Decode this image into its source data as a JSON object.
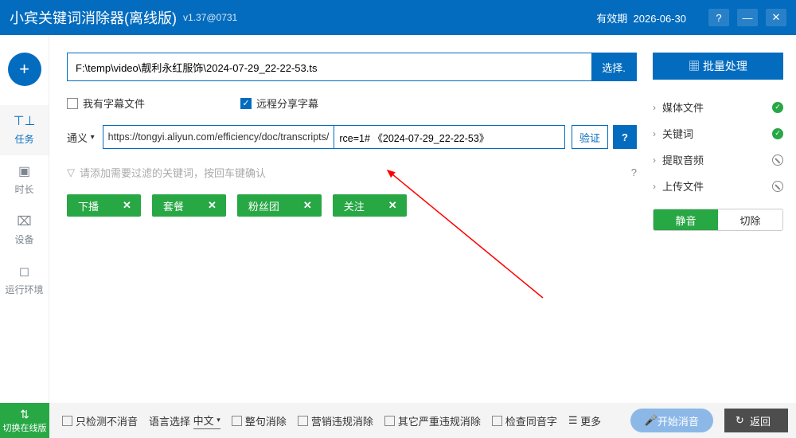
{
  "titlebar": {
    "title": "小宾关键词消除器(离线版)",
    "version": "v1.37@0731",
    "valid_label": "有效期",
    "valid_date": "2026-06-30"
  },
  "sidebar": {
    "items": [
      {
        "icon": "⊥",
        "label": "任务"
      },
      {
        "icon": "▣",
        "label": "时长"
      },
      {
        "icon": "⌧",
        "label": "设备"
      },
      {
        "icon": "◻",
        "label": "运行环境"
      }
    ]
  },
  "main": {
    "file_path": "F:\\temp\\video\\靓利永红服饰\\2024-07-29_22-22-53.ts",
    "choose_label": "选择.",
    "cb_subtitle": "我有字幕文件",
    "cb_share": "远程分享字幕",
    "engine": "通义",
    "url_prefix": "https://tongyi.aliyun.com/efficiency/doc/transcripts/",
    "url_value": "rce=1# 《2024-07-29_22-22-53》",
    "verify": "验证",
    "filter_hint": "请添加需要过滤的关键词，按回车键确认",
    "chips": [
      "下播",
      "套餐",
      "粉丝团",
      "关注"
    ]
  },
  "right": {
    "batch": "批量处理",
    "items": [
      {
        "label": "媒体文件",
        "state": "ok"
      },
      {
        "label": "关键词",
        "state": "ok"
      },
      {
        "label": "提取音频",
        "state": "no"
      },
      {
        "label": "上传文件",
        "state": "no"
      }
    ],
    "seg_on": "静音",
    "seg_off": "切除"
  },
  "footer": {
    "switch": "切换在线版",
    "detect_only": "只检测不消音",
    "lang_label": "语言选择",
    "lang_value": "中文",
    "opts": [
      "整句消除",
      "营销违规消除",
      "其它严重违规消除",
      "检查同音字"
    ],
    "more": "更多",
    "start": "开始消音",
    "back": "返回"
  }
}
